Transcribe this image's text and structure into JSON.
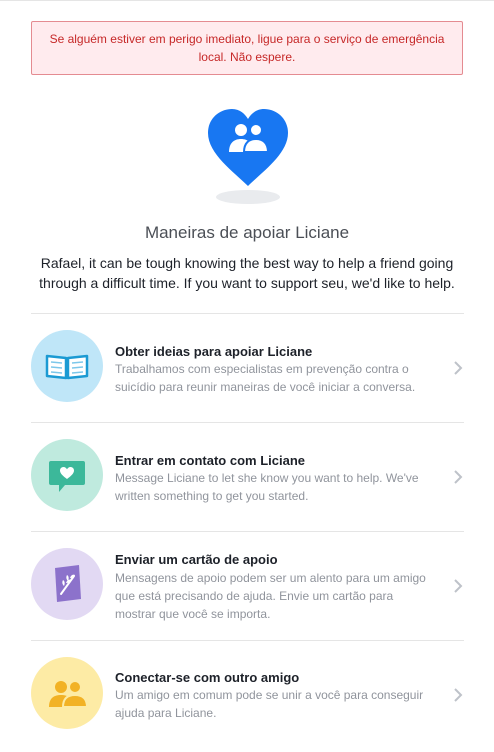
{
  "alert": {
    "text": "Se alguém estiver em perigo imediato, ligue para o serviço de emergência local. Não espere."
  },
  "hero": {
    "icon": "friends-heart-icon",
    "color": "#1877f2"
  },
  "title": "Maneiras de apoiar Liciane",
  "intro": "Rafael, it can be tough knowing the best way to help a friend going through a difficult time. If you want to support seu, we'd like to help.",
  "options": [
    {
      "title": "Obter ideias para apoiar Liciane",
      "description": "Trabalhamos com especialistas em prevenção contra o suicídio para reunir maneiras de você iniciar a conversa.",
      "icon": "book-icon",
      "circle_color": "#bfe6f8"
    },
    {
      "title": "Entrar em contato com Liciane",
      "description": "Message Liciane to let she know you want to help. We've written something to get you started.",
      "icon": "message-heart-icon",
      "circle_color": "#bfeade"
    },
    {
      "title": "Enviar um cartão de apoio",
      "description": "Mensagens de apoio podem ser um alento para um amigo que está precisando de ajuda. Envie um cartão para mostrar que você se importa.",
      "icon": "card-icon",
      "circle_color": "#e2d9f3"
    },
    {
      "title": "Conectar-se com outro amigo",
      "description": "Um amigo em comum pode se unir a você para conseguir ajuda para Liciane.",
      "icon": "friends-icon",
      "circle_color": "#fdeba5"
    }
  ]
}
